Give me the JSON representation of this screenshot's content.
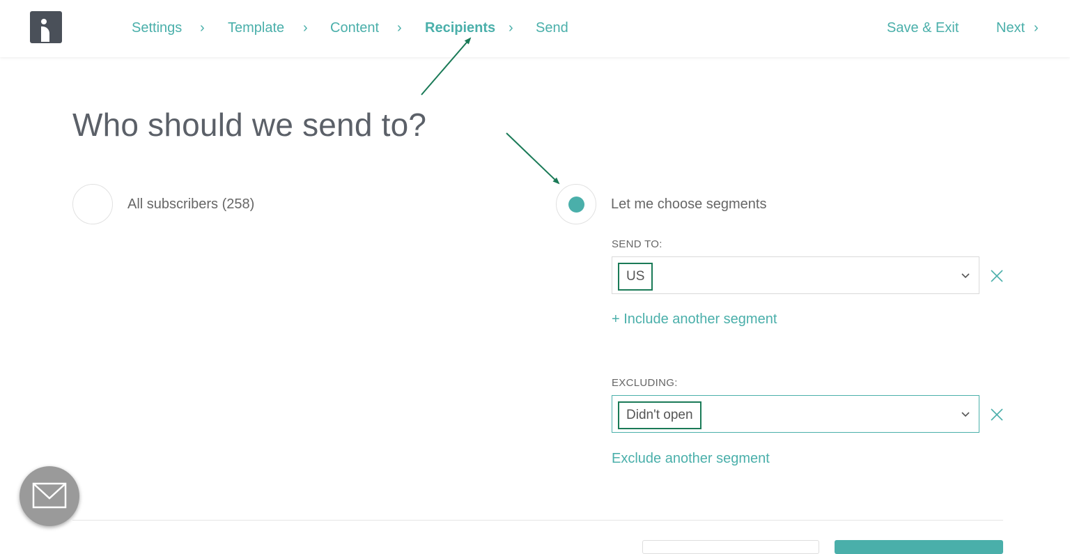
{
  "nav": {
    "steps": [
      {
        "label": "Settings"
      },
      {
        "label": "Template"
      },
      {
        "label": "Content"
      },
      {
        "label": "Recipients"
      },
      {
        "label": "Send"
      }
    ],
    "save_exit": "Save & Exit",
    "next": "Next"
  },
  "main": {
    "heading": "Who should we send to?",
    "option_all": "All subscribers (258)",
    "option_segments": "Let me choose segments",
    "selected_option": "segments",
    "send_to_label": "SEND TO:",
    "send_to_value": "US",
    "include_link": "+ Include another segment",
    "excluding_label": "EXCLUDING:",
    "excluding_value": "Didn't open",
    "exclude_link": "Exclude another segment"
  },
  "icons": {
    "chevron": "chevron-right-icon",
    "caret": "chevron-down-icon",
    "remove": "close-icon",
    "chat": "envelope-icon"
  },
  "colors": {
    "accent": "#4aafaa",
    "annotation": "#1a7a57",
    "logo": "#4a5059"
  }
}
